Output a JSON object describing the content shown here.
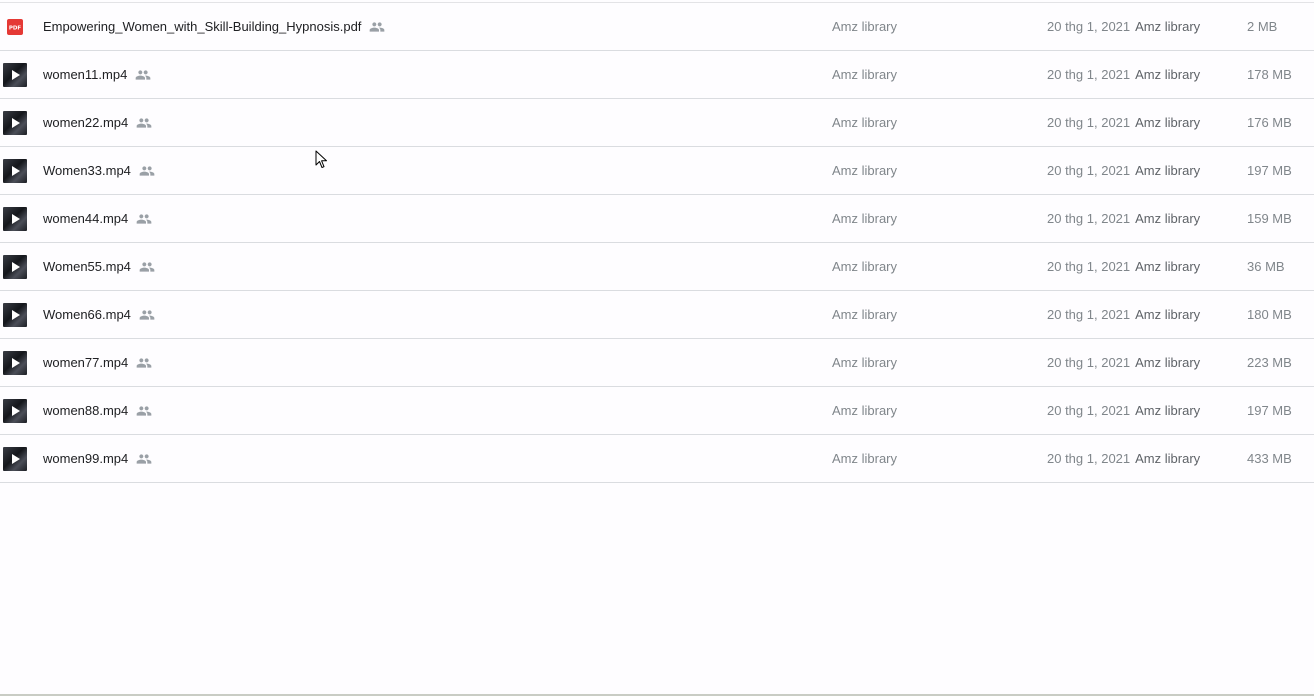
{
  "colors": {
    "background": "#fefdff",
    "divider": "#dadce0",
    "file_name": "#202124",
    "meta_text": "#80868b",
    "pdf_red": "#e53935",
    "icon_grey": "#9aa0a6"
  },
  "icons": {
    "pdf": "pdf-icon",
    "video": "video-thumbnail-icon",
    "shared": "people-icon",
    "cursor": "mouse-pointer-icon"
  },
  "files": [
    {
      "name": "Empowering_Women_with_Skill-Building_Hypnosis.pdf",
      "type": "pdf",
      "owner": "Amz library",
      "modified": "20 thg 1, 2021",
      "modified_by": "Amz library",
      "size": "2 MB"
    },
    {
      "name": "women11.mp4",
      "type": "video",
      "owner": "Amz library",
      "modified": "20 thg 1, 2021",
      "modified_by": "Amz library",
      "size": "178 MB"
    },
    {
      "name": "women22.mp4",
      "type": "video",
      "owner": "Amz library",
      "modified": "20 thg 1, 2021",
      "modified_by": "Amz library",
      "size": "176 MB"
    },
    {
      "name": "Women33.mp4",
      "type": "video",
      "owner": "Amz library",
      "modified": "20 thg 1, 2021",
      "modified_by": "Amz library",
      "size": "197 MB"
    },
    {
      "name": "women44.mp4",
      "type": "video",
      "owner": "Amz library",
      "modified": "20 thg 1, 2021",
      "modified_by": "Amz library",
      "size": "159 MB"
    },
    {
      "name": "Women55.mp4",
      "type": "video",
      "owner": "Amz library",
      "modified": "20 thg 1, 2021",
      "modified_by": "Amz library",
      "size": "36 MB"
    },
    {
      "name": "Women66.mp4",
      "type": "video",
      "owner": "Amz library",
      "modified": "20 thg 1, 2021",
      "modified_by": "Amz library",
      "size": "180 MB"
    },
    {
      "name": "women77.mp4",
      "type": "video",
      "owner": "Amz library",
      "modified": "20 thg 1, 2021",
      "modified_by": "Amz library",
      "size": "223 MB"
    },
    {
      "name": "women88.mp4",
      "type": "video",
      "owner": "Amz library",
      "modified": "20 thg 1, 2021",
      "modified_by": "Amz library",
      "size": "197 MB"
    },
    {
      "name": "women99.mp4",
      "type": "video",
      "owner": "Amz library",
      "modified": "20 thg 1, 2021",
      "modified_by": "Amz library",
      "size": "433 MB"
    }
  ]
}
